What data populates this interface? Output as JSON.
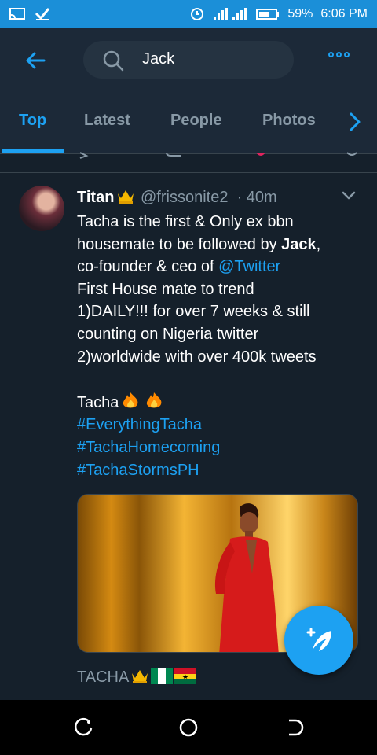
{
  "status_bar": {
    "battery": "59%",
    "time": "6:06 PM"
  },
  "search": {
    "query": "Jack"
  },
  "tabs": [
    {
      "label": "Top",
      "active": true
    },
    {
      "label": "Latest",
      "active": false
    },
    {
      "label": "People",
      "active": false
    },
    {
      "label": "Photos",
      "active": false
    }
  ],
  "tweet": {
    "name": "Titan",
    "handle": "@frissonite2",
    "time": "40m",
    "lines": {
      "l1": "Tacha is the first & Only ex bbn",
      "l2_pre": "housemate to be followed by ",
      "l2_bold": "Jack",
      "l2_post": ",",
      "l3_pre": "co-founder & ceo of ",
      "l3_link": "@Twitter",
      "l4": "First House mate to trend",
      "l5": "1)DAILY!!! for over 7 weeks & still",
      "l6": "counting on Nigeria twitter",
      "l7": "2)worldwide with over 400k tweets",
      "l8": "Tacha",
      "h1": "#EverythingTacha",
      "h2": "#TachaHomecoming",
      "h3": "#TachaStormsPH"
    },
    "media_caption": "TACHA"
  },
  "colors": {
    "accent": "#1da1f2",
    "background": "#15202b",
    "secondary_text": "#8899a6"
  },
  "icons": [
    "back-arrow-icon",
    "search-icon",
    "more-icon",
    "chevron-right-icon",
    "caret-down-icon",
    "crown-emoji",
    "fire-emoji",
    "nigeria-flag",
    "ghana-flag",
    "compose-icon",
    "recent-apps-icon",
    "home-icon",
    "back-icon"
  ]
}
